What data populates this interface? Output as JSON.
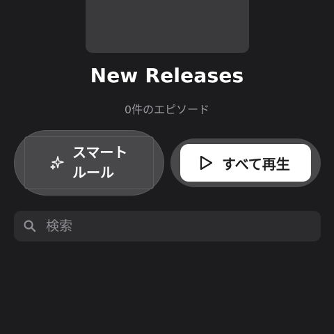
{
  "playlist": {
    "title": "New Releases",
    "episode_count": "0件のエピソード"
  },
  "actions": {
    "smart_rules_label_line1": "スマート",
    "smart_rules_label_line2": "ルール",
    "smart_rules_icon": "sparkles-icon",
    "play_all_label": "すべて再生",
    "play_all_icon": "play-outline-icon"
  },
  "search": {
    "placeholder": "検索",
    "value": "",
    "icon": "magnifying-glass-icon"
  },
  "colors": {
    "background": "#1c1c1e",
    "button_dark": "#48484a",
    "button_light": "#ffffff",
    "search_bg": "#2c2c2e",
    "secondary_text": "#98989d"
  }
}
